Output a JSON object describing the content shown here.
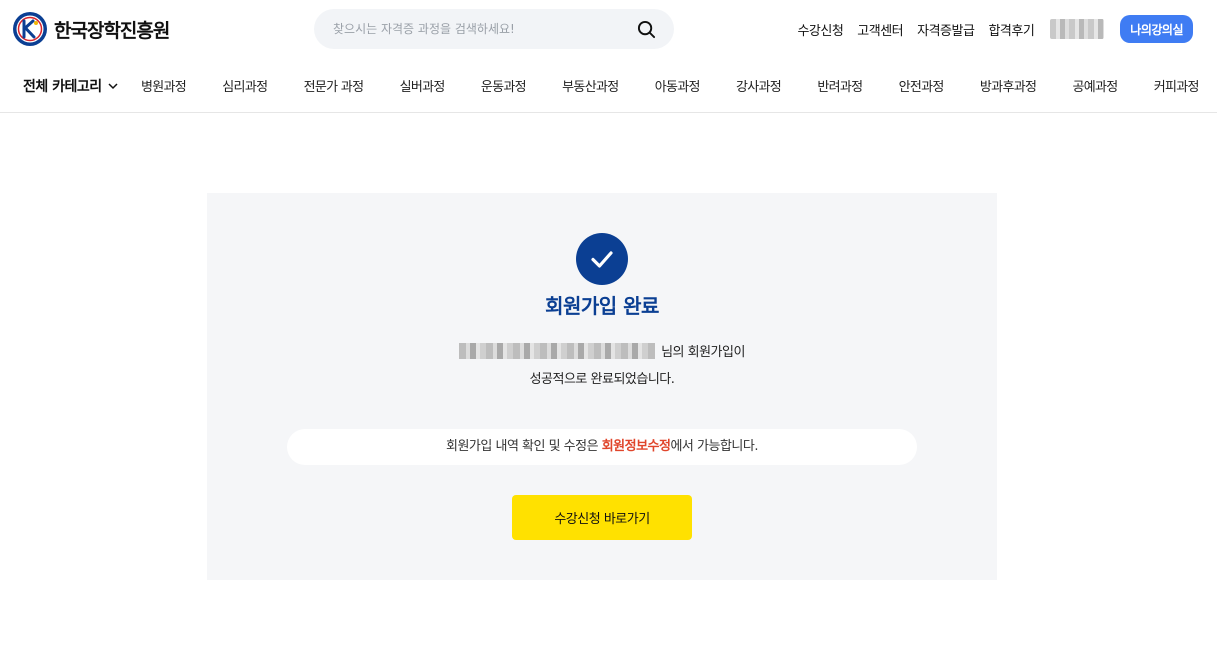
{
  "header": {
    "logo_text": "한국장학진흥원",
    "search": {
      "placeholder": "찾으시는 자격증 과정을 검색하세요!"
    },
    "util_links": [
      "수강신청",
      "고객센터",
      "자격증발급",
      "합격후기"
    ],
    "my_lecture_label": "나의강의실",
    "colors": {
      "accent": "#3f7cf3",
      "brand_navy": "#0b3f93"
    }
  },
  "nav": {
    "all_category_label": "전체 카테고리",
    "items": [
      "병원과정",
      "심리과정",
      "전문가 과정",
      "실버과정",
      "운동과정",
      "부동산과정",
      "아동과정",
      "강사과정",
      "반려과정",
      "안전과정",
      "방과후과정",
      "공예과정",
      "커피과정"
    ]
  },
  "main": {
    "icon": "check-circle-icon",
    "title": "회원가입 완료",
    "message_suffix": "님의 회원가입이",
    "message_line2": "성공적으로 완료되었습니다.",
    "info": {
      "before": "회원가입 내역 확인 및 수정은 ",
      "highlight": "회원정보수정",
      "after": "에서 가능합니다."
    },
    "cta_label": "수강신청 바로가기",
    "colors": {
      "highlight": "#e0452b",
      "cta": "#ffe100",
      "panel_bg": "#f5f6f8"
    }
  }
}
